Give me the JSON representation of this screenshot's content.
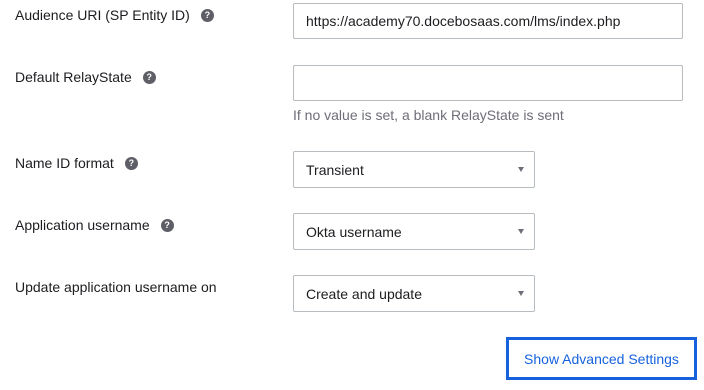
{
  "fields": {
    "audience_uri": {
      "label": "Audience URI (SP Entity ID)",
      "value": "https://academy70.docebosaas.com/lms/index.php"
    },
    "default_relaystate": {
      "label": "Default RelayState",
      "value": "",
      "hint": "If no value is set, a blank RelayState is sent"
    },
    "name_id_format": {
      "label": "Name ID format",
      "selected": "Transient"
    },
    "application_username": {
      "label": "Application username",
      "selected": "Okta username"
    },
    "update_username_on": {
      "label": "Update application username on",
      "selected": "Create and update"
    }
  },
  "help_icon_glyph": "?",
  "advanced_button_label": "Show Advanced Settings",
  "colors": {
    "accent": "#1662dd",
    "help_icon": "#5e5e66",
    "border": "#b7bcc0",
    "hint_text": "#6e6e78"
  }
}
